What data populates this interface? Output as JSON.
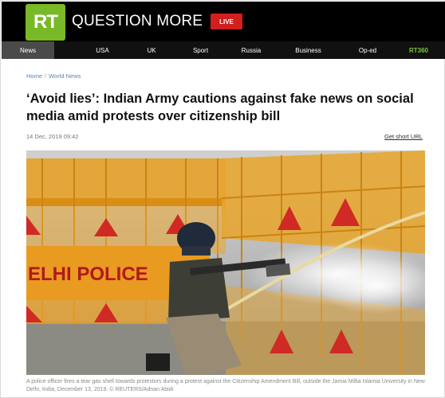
{
  "brand": {
    "logo": "RT",
    "tagline": "QUESTION MORE",
    "live_label": "LIVE"
  },
  "colors": {
    "brand_green": "#79b928",
    "live_red": "#d31e1e",
    "link_blue": "#5b85b5"
  },
  "nav": {
    "items": [
      {
        "label": "News",
        "active": true
      },
      {
        "label": "USA"
      },
      {
        "label": "UK"
      },
      {
        "label": "Sport"
      },
      {
        "label": "Russia"
      },
      {
        "label": "Business"
      },
      {
        "label": "Op-ed"
      },
      {
        "label": "RT360"
      }
    ]
  },
  "breadcrumb": {
    "home": "Home",
    "section": "World News"
  },
  "article": {
    "title": "‘Avoid lies’: Indian Army cautions against fake news on social media amid protests over citizenship bill",
    "date": "14 Dec, 2019 09:42",
    "short_url": "Get short URL",
    "image": {
      "sign_text": "ELHI POLICE",
      "caption": "A police officer fires a tear gas shell towards protestors during a protest against the Citizenship Amendment Bill, outside the Jamia Millia Islamia University in New Delhi, India, December 13, 2019. © REUTERS/Adnan Abidi"
    }
  }
}
